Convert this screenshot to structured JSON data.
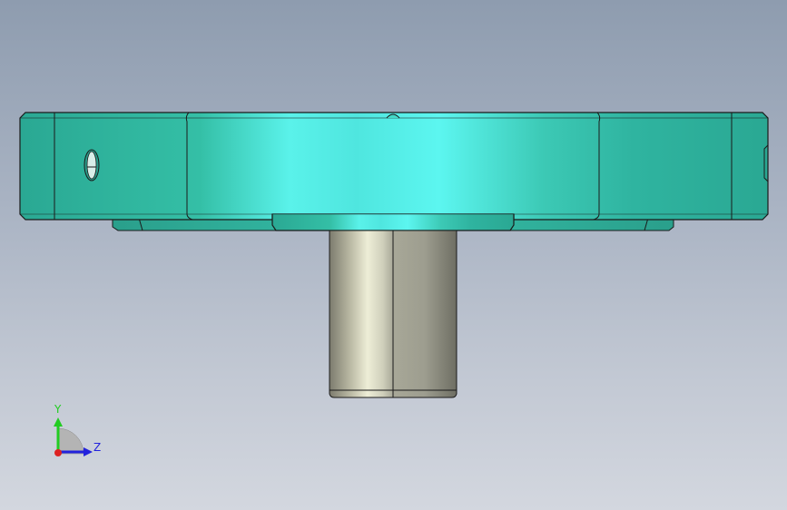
{
  "viewport": {
    "background_top": "#8e9caf",
    "background_bottom": "#d3d7df"
  },
  "model": {
    "flange_color": "#2fb5a0",
    "flange_highlight": "#5af5f0",
    "shaft_color": "#b8b8a8",
    "shaft_highlight": "#f0f0dc",
    "edge_color": "#1a1a1a"
  },
  "triad": {
    "y_label": "Y",
    "z_label": "Z",
    "y_color": "#22cc22",
    "z_color": "#2222dd",
    "origin_color": "#dd2222"
  }
}
